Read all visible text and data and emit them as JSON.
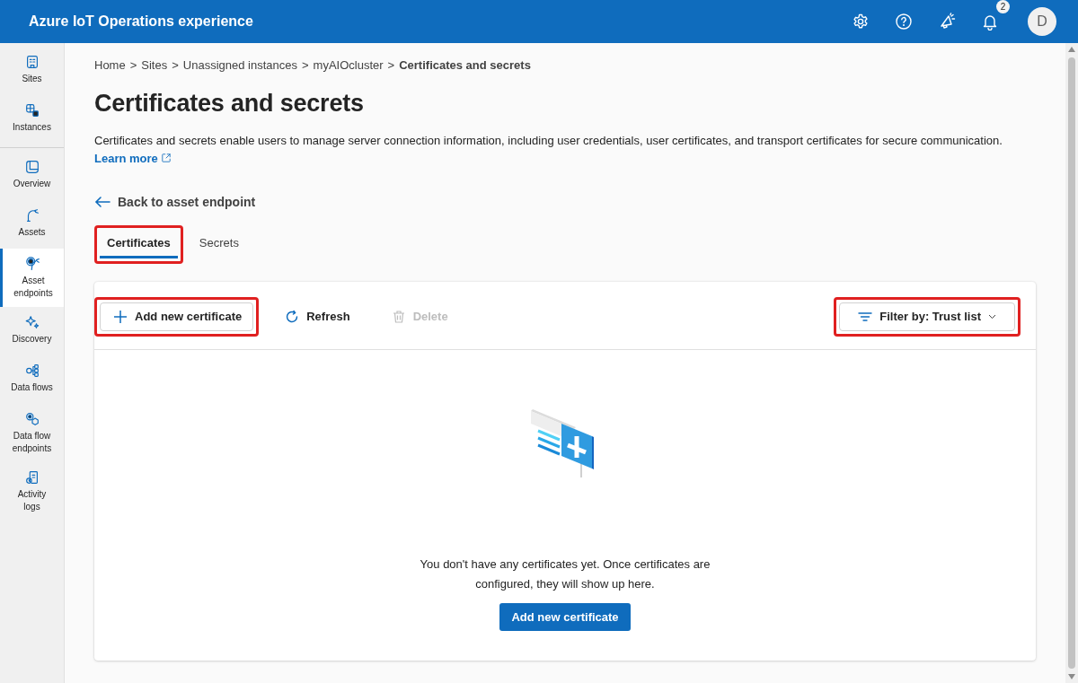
{
  "header": {
    "title": "Azure IoT Operations experience",
    "notification_count": "2",
    "avatar": "D"
  },
  "sidebar": {
    "groups": [
      {
        "items": [
          {
            "label": "Sites",
            "selected": false
          },
          {
            "label": "Instances",
            "selected": false
          }
        ]
      },
      {
        "items": [
          {
            "label": "Overview",
            "selected": false
          },
          {
            "label": "Assets",
            "selected": false
          },
          {
            "label": "Asset endpoints",
            "selected": true
          },
          {
            "label": "Discovery",
            "selected": false
          },
          {
            "label": "Data flows",
            "selected": false
          },
          {
            "label": "Data flow endpoints",
            "selected": false
          },
          {
            "label": "Activity logs",
            "selected": false
          }
        ]
      }
    ]
  },
  "breadcrumb": [
    "Home",
    ">",
    "Sites",
    ">",
    "Unassigned instances",
    ">",
    "myAIOcluster",
    ">",
    "Certificates and secrets"
  ],
  "page": {
    "title": "Certificates and secrets",
    "description": "Certificates and secrets enable users to manage server connection information, including user credentials, user certificates, and transport certificates for secure communication.",
    "learn_more": "Learn more",
    "back_link": "Back to asset endpoint"
  },
  "tabs": [
    {
      "label": "Certificates",
      "selected": true,
      "highlighted": true
    },
    {
      "label": "Secrets",
      "selected": false,
      "highlighted": false
    }
  ],
  "toolbar": [
    {
      "label": "Add new certificate",
      "kind": "add",
      "disabled": false,
      "highlighted": true
    },
    {
      "label": "Refresh",
      "kind": "refresh",
      "disabled": false,
      "highlighted": false
    },
    {
      "label": "Delete",
      "kind": "delete",
      "disabled": true,
      "highlighted": false
    }
  ],
  "filter": {
    "label": "Filter by: Trust list",
    "highlighted": true
  },
  "empty_state": {
    "message": "You don't have any certificates yet. Once certificates are configured, they will show up here.",
    "button": "Add new certificate"
  }
}
